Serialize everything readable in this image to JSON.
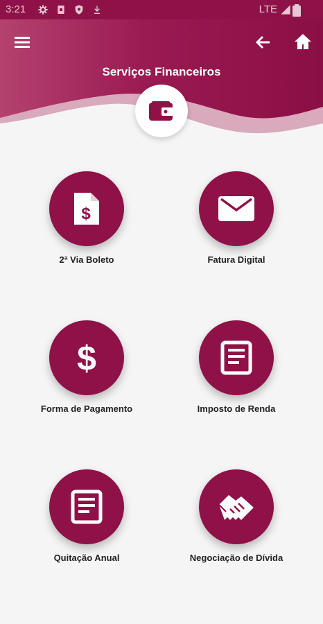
{
  "status_bar": {
    "time": "3:21",
    "network": "LTE"
  },
  "header": {
    "title": "Serviços Financeiros",
    "brand_color": "#8e1247",
    "menu_icon": "hamburger-menu-icon",
    "back_icon": "arrow-left-icon",
    "home_icon": "home-icon",
    "badge_icon": "wallet-icon"
  },
  "services": [
    {
      "label": "2ª Via Boleto",
      "icon": "invoice-dollar-icon"
    },
    {
      "label": "Fatura Digital",
      "icon": "envelope-icon"
    },
    {
      "label": "Forma de Pagamento",
      "icon": "dollar-icon"
    },
    {
      "label": "Imposto de Renda",
      "icon": "document-icon"
    },
    {
      "label": "Quitação Anual",
      "icon": "document-icon"
    },
    {
      "label": "Negociação de Dívida",
      "icon": "handshake-icon"
    }
  ]
}
